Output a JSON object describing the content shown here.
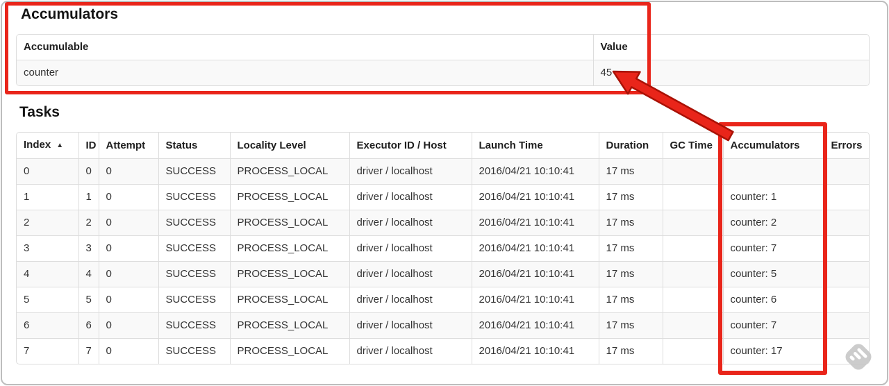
{
  "colors": {
    "annotation_red": "#e9251a",
    "annotation_red_outline": "#a91105",
    "table_border": "#dddddd",
    "stripe_row_bg": "#f9f9f9",
    "watermark_gray": "#c7c7c7"
  },
  "accumulators_section": {
    "title": "Accumulators",
    "table": {
      "headers": [
        "Accumulable",
        "Value"
      ],
      "rows": [
        {
          "accumulable": "counter",
          "value": "45"
        }
      ]
    }
  },
  "tasks_section": {
    "title": "Tasks",
    "table": {
      "sort_icon": "▲",
      "headers": [
        "Index",
        "ID",
        "Attempt",
        "Status",
        "Locality Level",
        "Executor ID / Host",
        "Launch Time",
        "Duration",
        "GC Time",
        "Accumulators",
        "Errors"
      ],
      "row_keys": [
        "index",
        "id",
        "attempt",
        "status",
        "locality_level",
        "executor_id_host",
        "launch_time",
        "duration",
        "gc_time",
        "accumulators",
        "errors"
      ],
      "rows": [
        {
          "index": "0",
          "id": "0",
          "attempt": "0",
          "status": "SUCCESS",
          "locality_level": "PROCESS_LOCAL",
          "executor_id_host": "driver / localhost",
          "launch_time": "2016/04/21 10:10:41",
          "duration": "17 ms",
          "gc_time": "",
          "accumulators": "",
          "errors": ""
        },
        {
          "index": "1",
          "id": "1",
          "attempt": "0",
          "status": "SUCCESS",
          "locality_level": "PROCESS_LOCAL",
          "executor_id_host": "driver / localhost",
          "launch_time": "2016/04/21 10:10:41",
          "duration": "17 ms",
          "gc_time": "",
          "accumulators": "counter: 1",
          "errors": ""
        },
        {
          "index": "2",
          "id": "2",
          "attempt": "0",
          "status": "SUCCESS",
          "locality_level": "PROCESS_LOCAL",
          "executor_id_host": "driver / localhost",
          "launch_time": "2016/04/21 10:10:41",
          "duration": "17 ms",
          "gc_time": "",
          "accumulators": "counter: 2",
          "errors": ""
        },
        {
          "index": "3",
          "id": "3",
          "attempt": "0",
          "status": "SUCCESS",
          "locality_level": "PROCESS_LOCAL",
          "executor_id_host": "driver / localhost",
          "launch_time": "2016/04/21 10:10:41",
          "duration": "17 ms",
          "gc_time": "",
          "accumulators": "counter: 7",
          "errors": ""
        },
        {
          "index": "4",
          "id": "4",
          "attempt": "0",
          "status": "SUCCESS",
          "locality_level": "PROCESS_LOCAL",
          "executor_id_host": "driver / localhost",
          "launch_time": "2016/04/21 10:10:41",
          "duration": "17 ms",
          "gc_time": "",
          "accumulators": "counter: 5",
          "errors": ""
        },
        {
          "index": "5",
          "id": "5",
          "attempt": "0",
          "status": "SUCCESS",
          "locality_level": "PROCESS_LOCAL",
          "executor_id_host": "driver / localhost",
          "launch_time": "2016/04/21 10:10:41",
          "duration": "17 ms",
          "gc_time": "",
          "accumulators": "counter: 6",
          "errors": ""
        },
        {
          "index": "6",
          "id": "6",
          "attempt": "0",
          "status": "SUCCESS",
          "locality_level": "PROCESS_LOCAL",
          "executor_id_host": "driver / localhost",
          "launch_time": "2016/04/21 10:10:41",
          "duration": "17 ms",
          "gc_time": "",
          "accumulators": "counter: 7",
          "errors": ""
        },
        {
          "index": "7",
          "id": "7",
          "attempt": "0",
          "status": "SUCCESS",
          "locality_level": "PROCESS_LOCAL",
          "executor_id_host": "driver / localhost",
          "launch_time": "2016/04/21 10:10:41",
          "duration": "17 ms",
          "gc_time": "",
          "accumulators": "counter: 17",
          "errors": ""
        }
      ]
    }
  }
}
